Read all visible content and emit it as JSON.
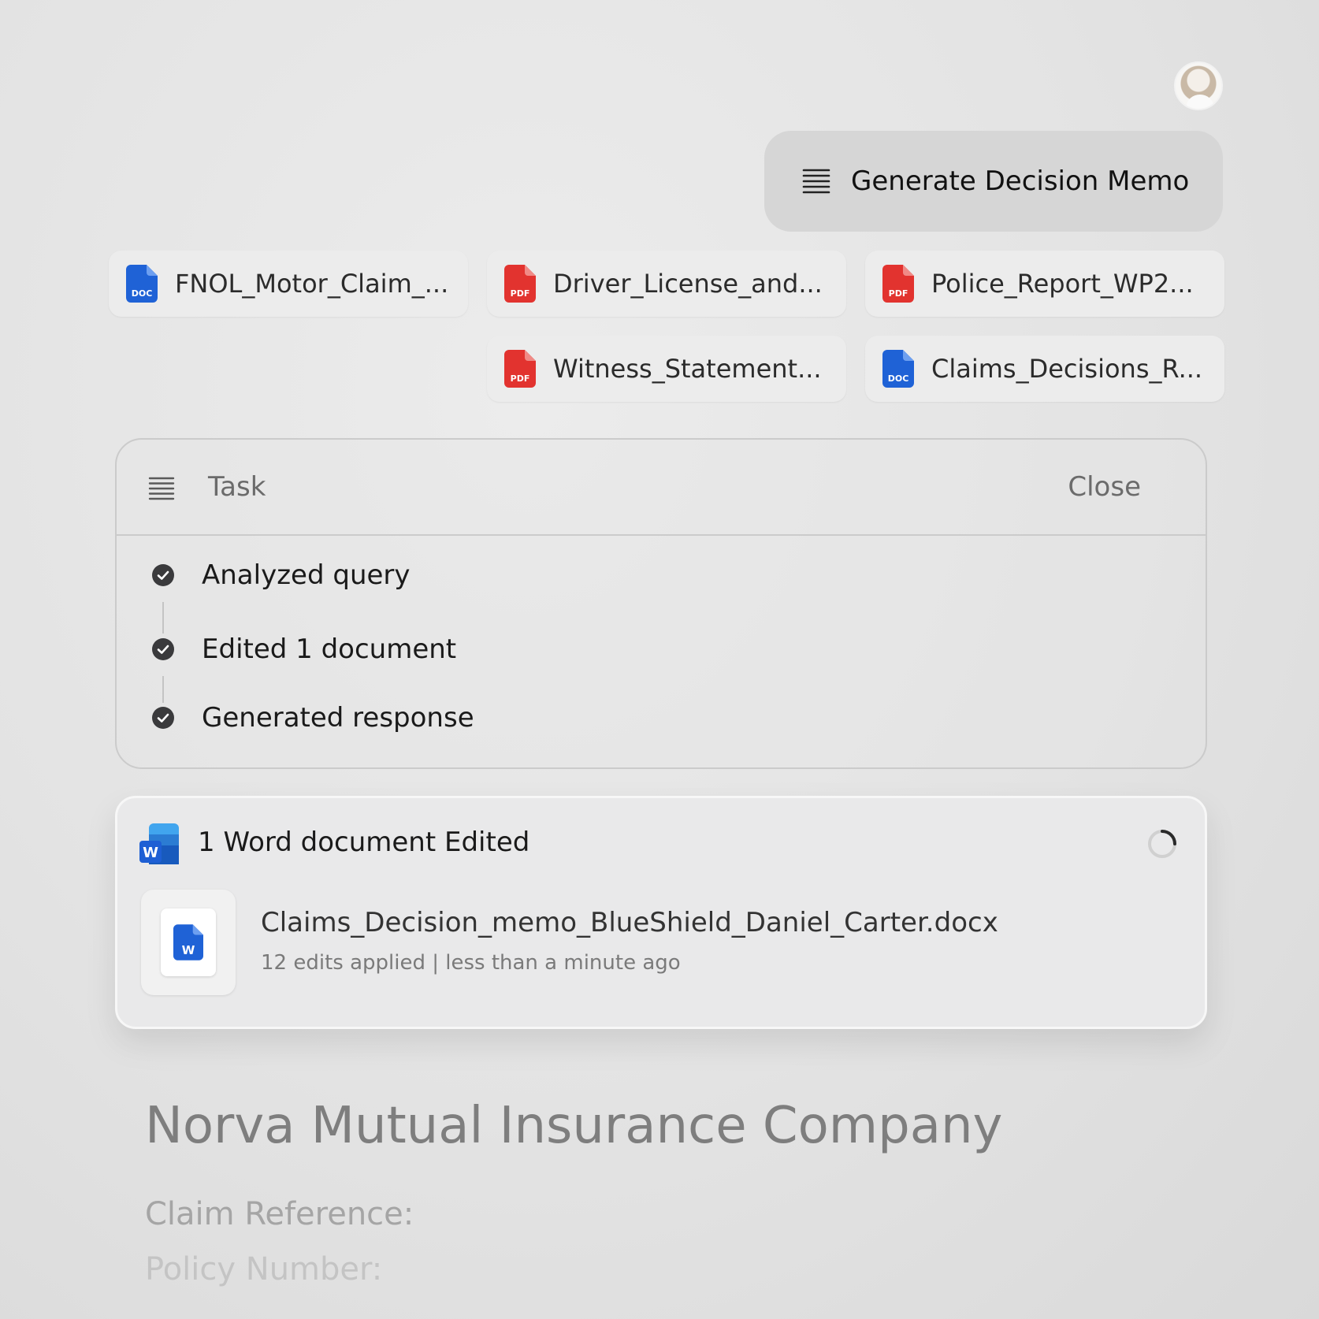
{
  "prompt": {
    "label": "Generate Decision Memo"
  },
  "attachments": [
    {
      "type": "DOC",
      "name": "FNOL_Motor_Claim_..."
    },
    {
      "type": "PDF",
      "name": "Driver_License_and..."
    },
    {
      "type": "PDF",
      "name": "Police_Report_WP2..."
    },
    {
      "type": "PDF",
      "name": "Witness_Statement..."
    },
    {
      "type": "DOC",
      "name": "Claims_Decisions_R..."
    }
  ],
  "task": {
    "title": "Task",
    "close_label": "Close",
    "steps": [
      {
        "label": "Analyzed query"
      },
      {
        "label": "Edited 1 document"
      },
      {
        "label": "Generated response"
      }
    ]
  },
  "edited": {
    "title": "1 Word document Edited",
    "icon_letter": "W",
    "file_name": "Claims_Decision_memo_BlueShield_Daniel_Carter.docx",
    "meta": "12 edits applied | less than a minute ago"
  },
  "document": {
    "company": "Norva Mutual Insurance Company",
    "claim_reference_label": "Claim Reference:",
    "policy_number_label": "Policy Number:"
  },
  "colors": {
    "pdf": "#e2332f",
    "doc": "#1f62d6",
    "word": "#1e5fd4",
    "check": "#3a3a3c"
  }
}
